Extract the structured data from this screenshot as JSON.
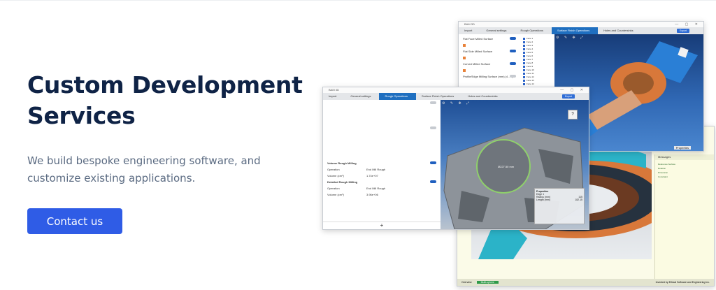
{
  "hero": {
    "title": "Custom Development Services",
    "subtitle": "We build bespoke engineering software, and customize existing applications.",
    "cta_label": "Contact us"
  },
  "back_window": {
    "title": "BAM 3D",
    "steps": [
      "Import",
      "General settings",
      "Rough Operations",
      "Surface Finish Operations",
      "Holes and Countersinks"
    ],
    "active_step": 3,
    "action_label": "Export",
    "ops": [
      {
        "label": "Flat Face Milled Surface",
        "toggle": true,
        "color": "#e8823a"
      },
      {
        "label": "Flat Side Milled Surface",
        "toggle": true,
        "color": "#e8823a"
      },
      {
        "label": "Curved Milled Surface",
        "toggle": true,
        "color": "#e8823a"
      },
      {
        "label": "Profile/Edge Milling Surface (mm) (4 - 4)",
        "toggle": false,
        "color": "#e8823a"
      }
    ],
    "layers": [
      "Face 1",
      "Face 2",
      "Face 3",
      "Face 4",
      "Face 5",
      "Face 6",
      "Face 7",
      "Face 8",
      "Face 9",
      "Face 10",
      "Face 11",
      "Face 12",
      "Face 13",
      "Face 14",
      "Face 15",
      "Face 16",
      "Face 17"
    ],
    "viewport_footer": "Properties"
  },
  "front_window": {
    "title": "BAM 3D",
    "steps": [
      "Import",
      "General settings",
      "Rough Operations",
      "Surface Finish Operations",
      "Holes and Countersinks"
    ],
    "active_step": 2,
    "action_label": "Export",
    "rows": [
      {
        "label": "Volume Rough Milling",
        "value": "",
        "toggle": true
      },
      {
        "label": "Operation",
        "value": "End Mill Rough",
        "toggle": null
      },
      {
        "label": "Volume (cm³)",
        "value": "1.74e+07",
        "toggle": null
      },
      {
        "label": "Detailed Rough Milling",
        "value": "",
        "toggle": true
      },
      {
        "label": "Operation",
        "value": "End Mill Rough",
        "toggle": null
      },
      {
        "label": "Volume (cm³)",
        "value": "3.96e+06",
        "toggle": null
      }
    ],
    "add_icon": "+",
    "properties": {
      "title": "Properties",
      "item": "Edge 1",
      "fields": [
        [
          "Radius (mm)",
          "115"
        ],
        [
          "Length (mm)",
          "182.15"
        ]
      ]
    },
    "dimension_label": "Ø227.50 mm"
  },
  "third_window": {
    "panel_tabs": [
      "Messages"
    ],
    "messages": [
      "Reference Surface",
      "Rotation",
      "Dimension",
      "Constraint"
    ],
    "footer_tabs": [
      "Overview",
      "Multi-sphere"
    ],
    "footer_status": "Invented by Ethical Software and Engineering Inc."
  },
  "colors": {
    "brand_navy": "#0f2346",
    "accent_blue": "#2f5ce6",
    "viewport_blue": "#1f4f96",
    "part_orange": "#d8783a",
    "part_teal": "#2bb3c8"
  }
}
